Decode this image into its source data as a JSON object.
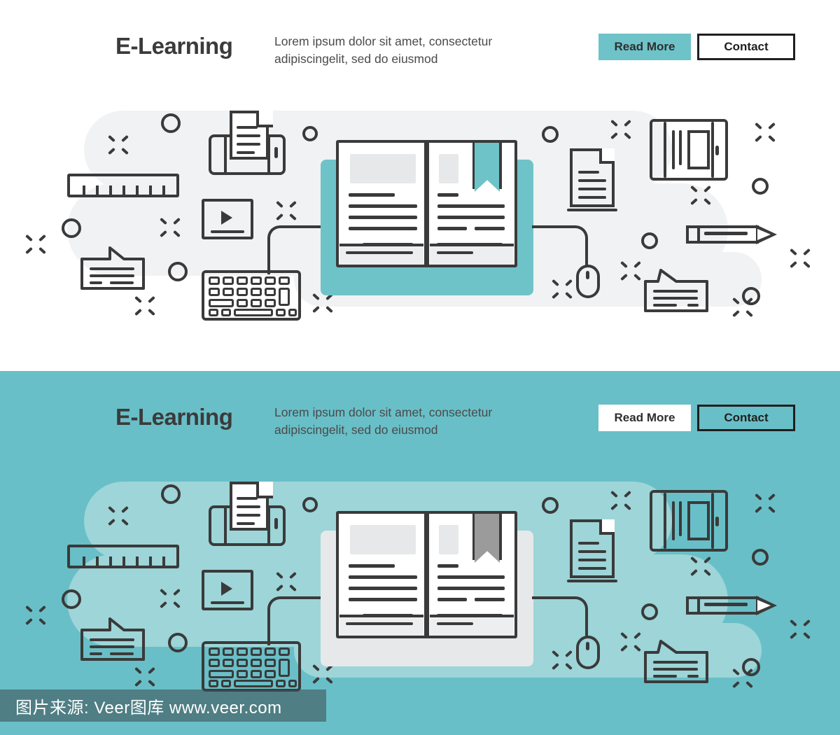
{
  "page": {
    "banners": [
      {
        "id": "light",
        "theme": "white",
        "background_color": "#FFFFFF",
        "accent_color": "#6EC3C9",
        "blob_color": "#F1F2F3",
        "title": "E-Learning",
        "subtitle_line1": "Lorem ipsum dolor sit amet, consectetur",
        "subtitle_line2": "adipiscingelit, sed do eiusmod",
        "read_more_label": "Read More",
        "contact_label": "Contact",
        "book_panel_color": "#6EC3C9",
        "book_ribbon_color": "#6EC3C9"
      },
      {
        "id": "teal",
        "theme": "teal",
        "background_color": "#69BFC7",
        "accent_color": "#FFFFFF",
        "blob_color": "#9DD5D8",
        "title": "E-Learning",
        "subtitle_line1": "Lorem ipsum dolor sit amet, consectetur",
        "subtitle_line2": "adipiscingelit, sed do eiusmod",
        "read_more_label": "Read More",
        "contact_label": "Contact",
        "book_panel_color": "#E7E8E9",
        "book_ribbon_color": "#9B9B9B"
      }
    ],
    "illustration_icons": [
      "ruler-icon",
      "printer-icon",
      "video-player-icon",
      "speech-bubble-icon",
      "keyboard-icon",
      "open-book-icon",
      "document-icon",
      "tablet-bookshelf-icon",
      "pencil-icon",
      "mouse-icon",
      "circle-decoration",
      "sparkle-decoration"
    ],
    "watermark": {
      "text": "图片来源: Veer图库 www.veer.com"
    },
    "colors": {
      "line": "#3A3A3A",
      "teal": "#6EC3C9",
      "teal_dark": "#69BFC7",
      "teal_light": "#9DD5D8",
      "gray_light": "#F1F2F3",
      "gray_block": "#E7E8E9",
      "text_dark": "#3B3B3B"
    }
  }
}
